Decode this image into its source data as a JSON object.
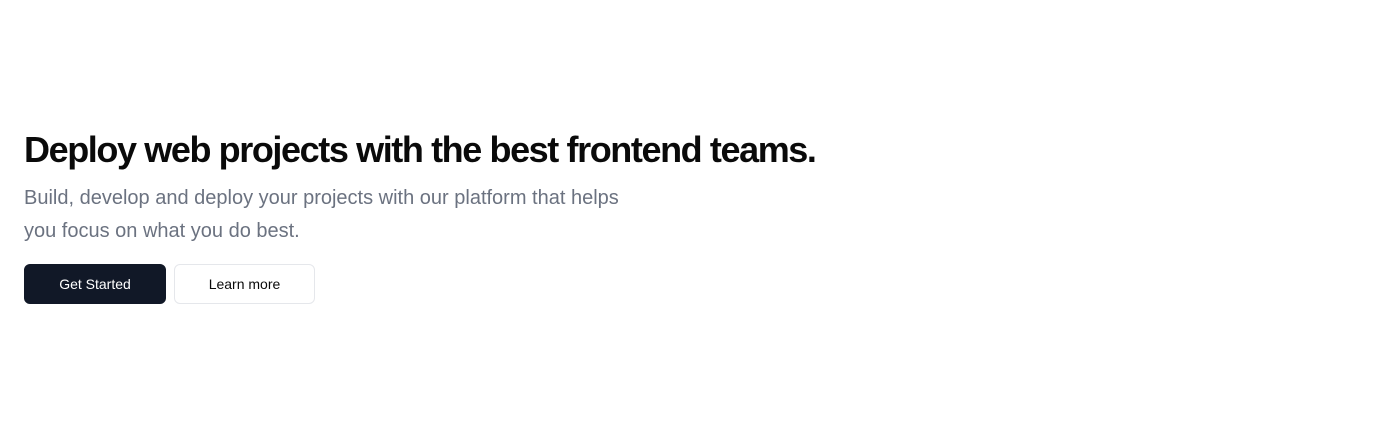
{
  "hero": {
    "title": "Deploy web projects with the best frontend teams.",
    "subtitle": "Build, develop and deploy your projects with our platform that helps you focus on what you do best.",
    "primary_button": "Get Started",
    "secondary_button": "Learn more"
  },
  "colors": {
    "background": "#ffffff",
    "title": "#0a0a0a",
    "subtitle": "#6b7280",
    "primary_button_bg": "#111827",
    "primary_button_text": "#ffffff",
    "secondary_button_border": "#e5e7eb"
  }
}
